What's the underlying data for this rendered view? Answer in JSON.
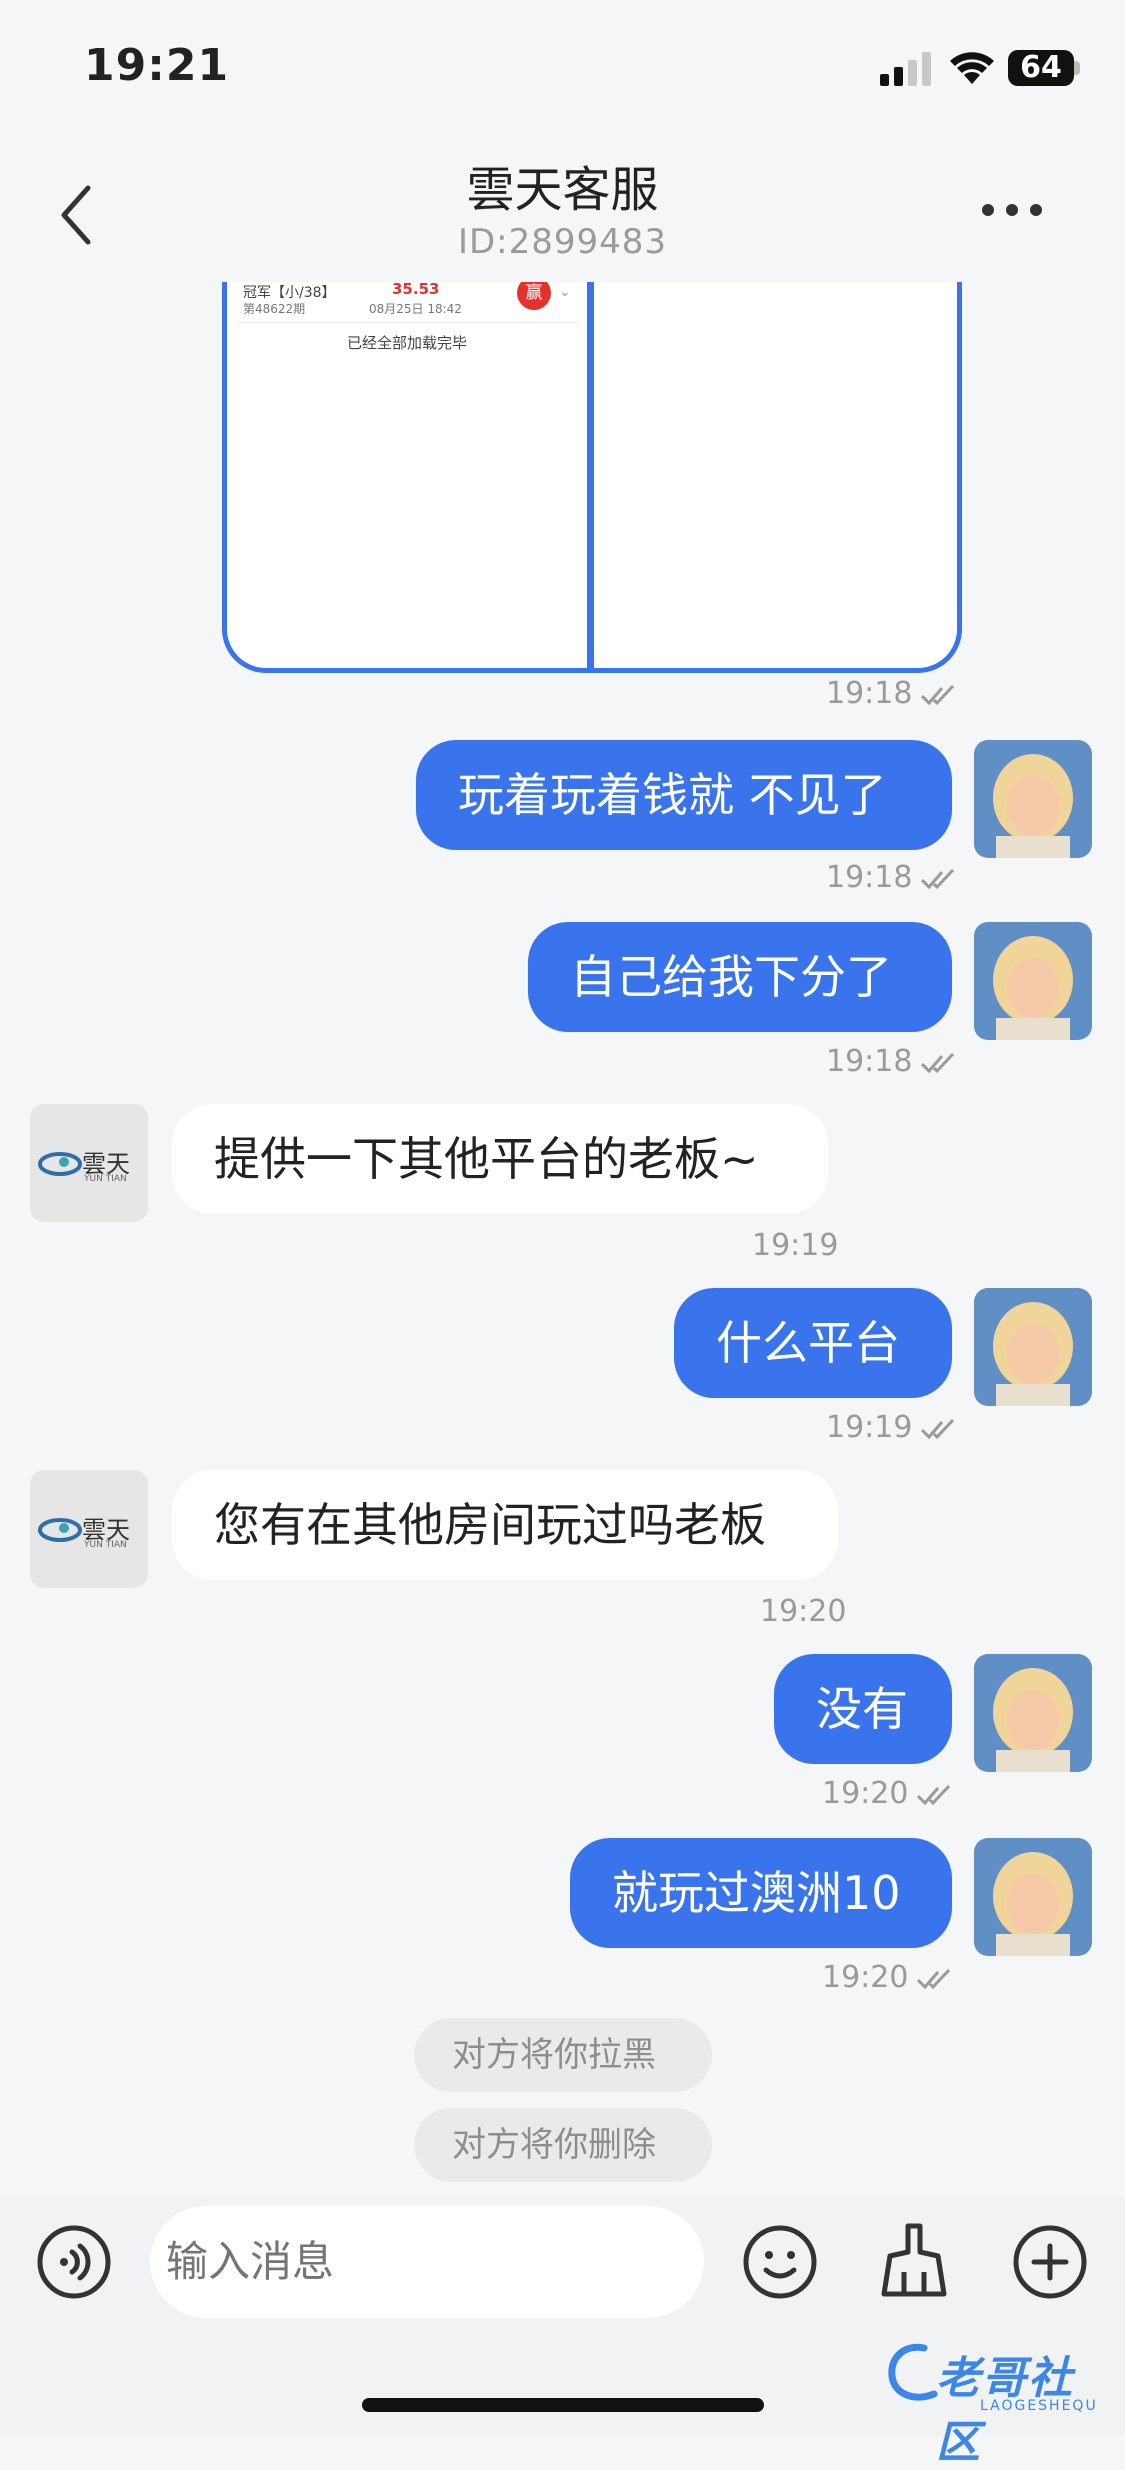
{
  "status_bar": {
    "time": "19:21",
    "battery": "64"
  },
  "header": {
    "title": "雲天客服",
    "subtitle": "ID:2899483"
  },
  "image_message": {
    "row_title": "冠军【小/38】",
    "row_amount": "35.53",
    "row_issue": "第48622期",
    "row_date": "08月25日 18:42",
    "row_badge": "赢",
    "footer": "已经全部加载完毕",
    "time": "19:18"
  },
  "messages": [
    {
      "side": "out",
      "text": "玩着玩着钱就 不见了",
      "time": "19:18"
    },
    {
      "side": "out",
      "text": "自己给我下分了",
      "time": "19:18"
    },
    {
      "side": "in",
      "text": "提供一下其他平台的老板~",
      "time": "19:19"
    },
    {
      "side": "out",
      "text": "什么平台",
      "time": "19:19"
    },
    {
      "side": "in",
      "text": "您有在其他房间玩过吗老板",
      "time": "19:20"
    },
    {
      "side": "out",
      "text": "没有",
      "time": "19:20"
    },
    {
      "side": "out",
      "text": "就玩过澳洲10",
      "time": "19:20"
    }
  ],
  "agent_logo": {
    "main": "雲天",
    "sub": "YUN TIAN"
  },
  "system_notes": [
    "对方将你拉黑",
    "对方将你删除"
  ],
  "input_bar": {
    "placeholder": "输入消息"
  },
  "watermark": {
    "main": "老哥社区",
    "sub": "LAOGESHEQU"
  },
  "colors": {
    "accent": "#3a74ec",
    "background": "#f5f6f8"
  }
}
